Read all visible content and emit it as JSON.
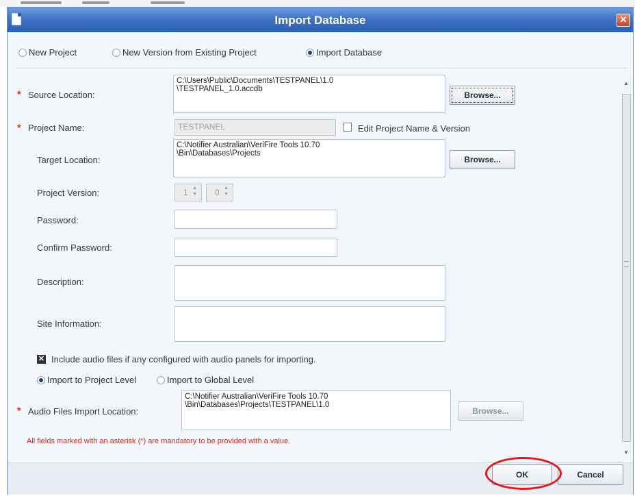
{
  "window": {
    "title": "Import Database",
    "close_glyph": "✕"
  },
  "mode": {
    "options": [
      "New Project",
      "New Version from Existing Project",
      "Import Database"
    ],
    "selected": "Import Database"
  },
  "form": {
    "asterisk": "*",
    "source_location": {
      "label": "Source Location:",
      "value": "C:\\Users\\Public\\Documents\\TESTPANEL\\1.0\n\\TESTPANEL_1.0.accdb",
      "browse": "Browse..."
    },
    "project_name": {
      "label": "Project Name:",
      "value": "TESTPANEL",
      "edit_checkbox_label": "Edit Project Name & Version",
      "edit_checked": false
    },
    "target_location": {
      "label": "Target Location:",
      "value": "C:\\Notifier Australian\\VeriFire Tools 10.70\n\\Bin\\Databases\\Projects",
      "browse": "Browse..."
    },
    "project_version": {
      "label": "Project Version:",
      "major": "1",
      "minor": "0"
    },
    "password": {
      "label": "Password:",
      "value": ""
    },
    "confirm_password": {
      "label": "Confirm Password:",
      "value": ""
    },
    "description": {
      "label": "Description:",
      "value": ""
    },
    "site_information": {
      "label": "Site Information:",
      "value": ""
    },
    "include_audio": {
      "label": "Include audio files if any configured with audio panels for importing.",
      "checked": true
    },
    "import_level": {
      "options": [
        "Import to Project Level",
        "Import to Global Level"
      ],
      "selected": "Import to Project Level"
    },
    "audio_location": {
      "label": "Audio Files Import Location:",
      "value": "C:\\Notifier Australian\\VeriFire Tools 10.70\n\\Bin\\Databases\\Projects\\TESTPANEL\\1.0",
      "browse": "Browse..."
    },
    "mandatory_note": "All fields marked with an asterisk (*) are mandatory to be provided with a value."
  },
  "buttons": {
    "ok": "OK",
    "cancel": "Cancel"
  },
  "icons": [
    "app-icon",
    "close-icon",
    "scroll-up-icon",
    "scroll-down-icon",
    "scroll-grip-icon"
  ],
  "colors": {
    "titlebar": "#3f73c6",
    "mandatory": "#e0271c",
    "highlight": "#e01b1b"
  }
}
